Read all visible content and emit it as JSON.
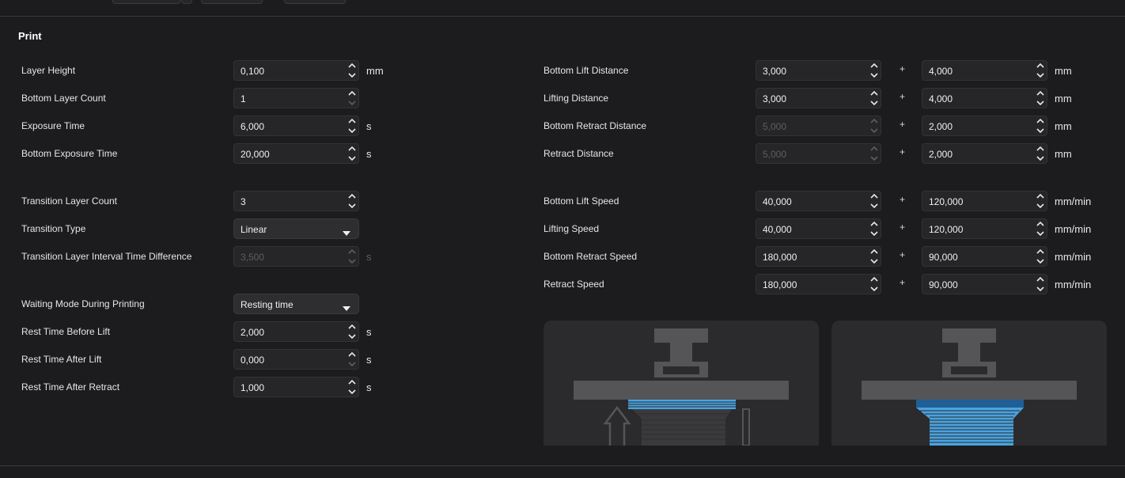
{
  "section": {
    "title": "Print"
  },
  "left": {
    "layer_height": {
      "label": "Layer Height",
      "value": "0,100",
      "unit": "mm"
    },
    "bottom_layer_count": {
      "label": "Bottom Layer Count",
      "value": "1"
    },
    "exposure_time": {
      "label": "Exposure Time",
      "value": "6,000",
      "unit": "s"
    },
    "bottom_exposure_time": {
      "label": "Bottom Exposure Time",
      "value": "20,000",
      "unit": "s"
    },
    "transition_layer_count": {
      "label": "Transition Layer Count",
      "value": "3"
    },
    "transition_type": {
      "label": "Transition Type",
      "value": "Linear"
    },
    "transition_interval": {
      "label": "Transition Layer Interval Time Difference",
      "value": "3,500",
      "unit": "s"
    },
    "waiting_mode": {
      "label": "Waiting Mode During Printing",
      "value": "Resting time"
    },
    "rest_before_lift": {
      "label": "Rest Time Before Lift",
      "value": "2,000",
      "unit": "s"
    },
    "rest_after_lift": {
      "label": "Rest Time After Lift",
      "value": "0,000",
      "unit": "s"
    },
    "rest_after_retract": {
      "label": "Rest Time After Retract",
      "value": "1,000",
      "unit": "s"
    }
  },
  "right": {
    "plus": "+",
    "bottom_lift_distance": {
      "label": "Bottom Lift Distance",
      "value1": "3,000",
      "value2": "4,000",
      "unit": "mm"
    },
    "lifting_distance": {
      "label": "Lifting Distance",
      "value1": "3,000",
      "value2": "4,000",
      "unit": "mm"
    },
    "bottom_retract_distance": {
      "label": "Bottom Retract Distance",
      "value1": "5,000",
      "value2": "2,000",
      "unit": "mm"
    },
    "retract_distance": {
      "label": "Retract Distance",
      "value1": "5,000",
      "value2": "2,000",
      "unit": "mm"
    },
    "bottom_lift_speed": {
      "label": "Bottom Lift Speed",
      "value1": "40,000",
      "value2": "120,000",
      "unit": "mm/min"
    },
    "lifting_speed": {
      "label": "Lifting Speed",
      "value1": "40,000",
      "value2": "120,000",
      "unit": "mm/min"
    },
    "bottom_retract_speed": {
      "label": "Bottom Retract Speed",
      "value1": "180,000",
      "value2": "90,000",
      "unit": "mm/min"
    },
    "retract_speed": {
      "label": "Retract Speed",
      "value1": "180,000",
      "value2": "90,000",
      "unit": "mm/min"
    }
  },
  "colors": {
    "background": "#1c1c1e",
    "field": "#262628",
    "resin_blue": "#4aa3e0",
    "printer_gray": "#555557"
  }
}
